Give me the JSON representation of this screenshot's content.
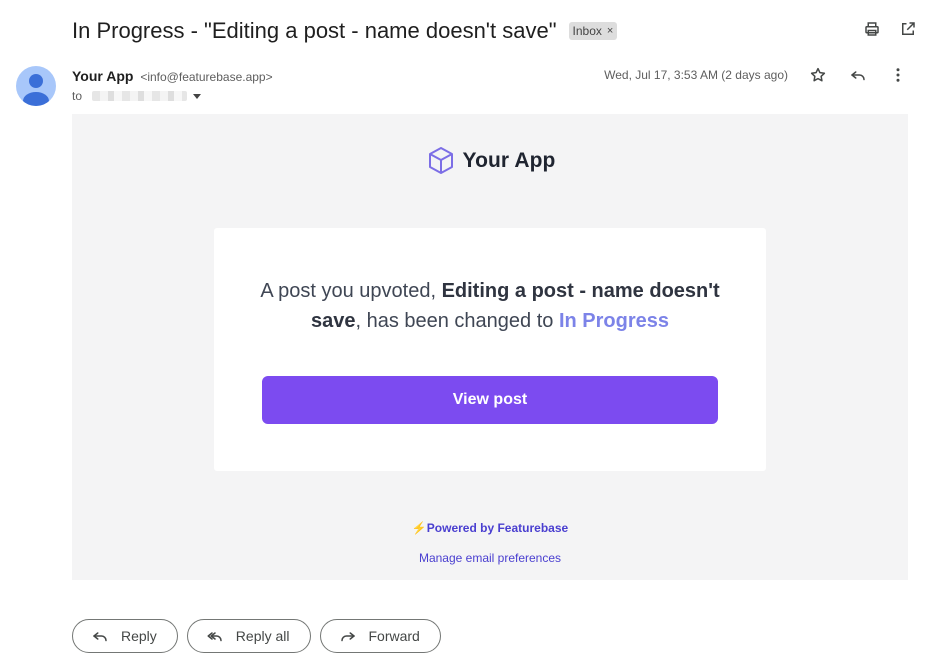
{
  "email": {
    "subject": "In Progress - \"Editing a post - name doesn't save\"",
    "label": "Inbox",
    "label_remove": "×",
    "sender_name": "Your App",
    "sender_email": "<info@featurebase.app>",
    "to_prefix": "to",
    "date": "Wed, Jul 17, 3:53 AM (2 days ago)"
  },
  "body": {
    "brand_name": "Your App",
    "message_prefix": "A post you upvoted, ",
    "post_title": "Editing a post - name doesn't save",
    "message_middle": ", has been changed to ",
    "status": "In Progress",
    "view_button": "View post",
    "powered_by": "Powered by Featurebase",
    "manage_link": "Manage email preferences"
  },
  "actions": {
    "reply": "Reply",
    "reply_all": "Reply all",
    "forward": "Forward"
  },
  "icons": {
    "print": "print-icon",
    "open_new_window": "open-in-new-window-icon",
    "star": "star-icon",
    "reply": "reply-icon",
    "more": "more-vertical-icon",
    "logo": "cube-icon",
    "bolt": "lightning-icon"
  },
  "colors": {
    "accent_button": "#7c4bf0",
    "status_text": "#7c83e8",
    "link": "#4a3fd0",
    "body_bg": "#f4f4f5"
  }
}
